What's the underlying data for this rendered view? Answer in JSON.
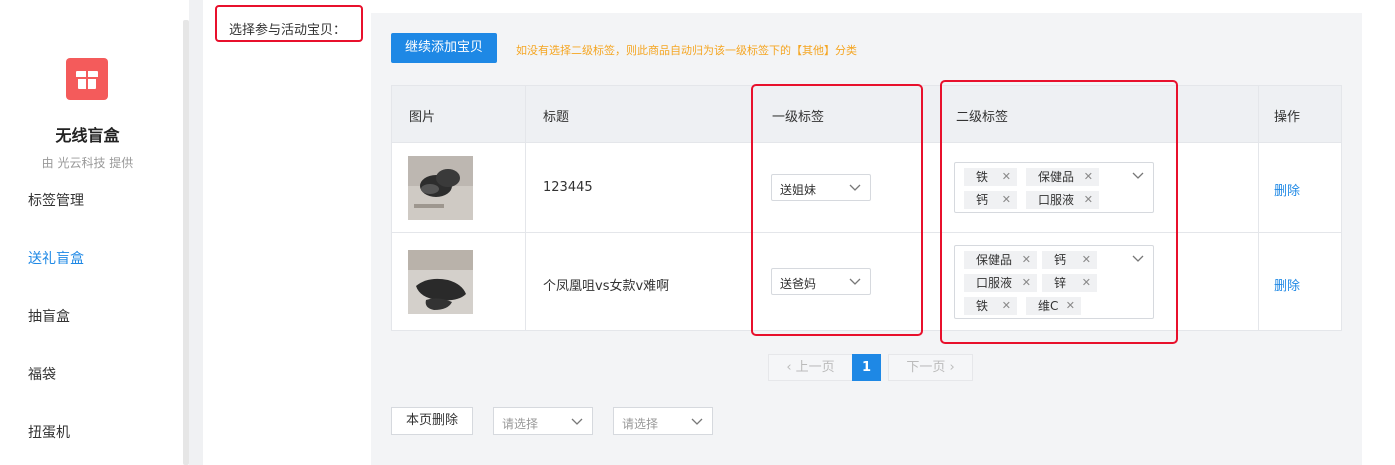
{
  "sidebar": {
    "app_title": "无线盲盒",
    "app_subtitle": "由 光云科技 提供",
    "logo_icon": "gift-box-icon",
    "items": [
      {
        "label": "标签管理",
        "active": false
      },
      {
        "label": "送礼盲盒",
        "active": true
      },
      {
        "label": "抽盲盒",
        "active": false
      },
      {
        "label": "福袋",
        "active": false
      },
      {
        "label": "扭蛋机",
        "active": false
      }
    ]
  },
  "main": {
    "section_label": "选择参与活动宝贝：",
    "add_button_label": "继续添加宝贝",
    "hint_text": "如没有选择二级标签，则此商品自动归为该一级标签下的【其他】分类",
    "table": {
      "headers": [
        "图片",
        "标题",
        "一级标签",
        "二级标签",
        "操作"
      ],
      "rows": [
        {
          "title": "123445",
          "level1_tag": "送姐妹",
          "level2_tags": [
            "铁",
            "保健品",
            "钙",
            "口服液"
          ],
          "action": "删除"
        },
        {
          "title": "个凤凰咀vs女款v难啊",
          "level1_tag": "送爸妈",
          "level2_tags": [
            "保健品",
            "钙",
            "口服液",
            "锌",
            "铁",
            "维C"
          ],
          "action": "删除"
        }
      ]
    },
    "pagination": {
      "prev": "上一页",
      "current": "1",
      "next": "下一页"
    },
    "bottom": {
      "bulk_delete": "本页删除",
      "select1_placeholder": "请选择",
      "select2_placeholder": "请选择"
    }
  },
  "colors": {
    "accent": "#1e88e5",
    "highlight_box": "#e8102c",
    "hint": "#f5a623",
    "logo": "#f45b5b"
  }
}
